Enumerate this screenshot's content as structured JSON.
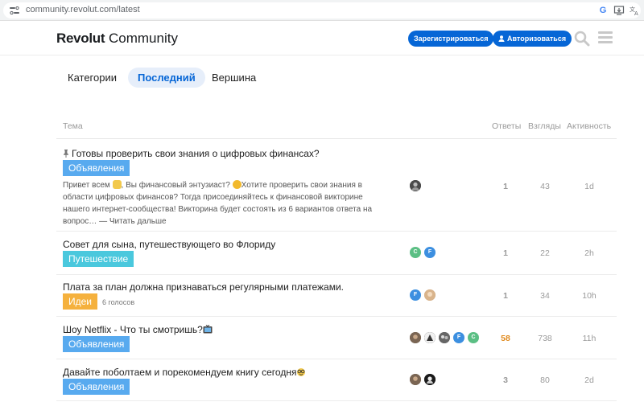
{
  "browser": {
    "url": "community.revolut.com/latest"
  },
  "header": {
    "brand": "Revolut",
    "brand_suffix": "Community",
    "signup_label": "Зарегистрироваться",
    "login_label": "Авторизоваться",
    "colors": {
      "primary": "#0666d6"
    }
  },
  "nav": {
    "tabs": [
      {
        "label": "Категории"
      },
      {
        "label": "Последний"
      },
      {
        "label": "Вершина"
      }
    ]
  },
  "table": {
    "headers": {
      "topic": "Тема",
      "replies": "Ответы",
      "views": "Взгляды",
      "activity": "Активность"
    },
    "rows": [
      {
        "title": "Готовы проверить свои знания о цифровых финансах?",
        "category": "Объявления",
        "category_color": "#58aaef",
        "excerpt_1": "Привет всем",
        "excerpt_2": ", Вы финансовый энтузиаст?",
        "excerpt_3": "Хотите проверить свои знания в области цифровых финансов? Тогда присоединяйтесь к финансовой викторине нашего интернет-сообщества! Викторина будет состоять из 6 вариантов ответа на вопрос…",
        "read_more": "— Читать дальше",
        "replies": "1",
        "views": "43",
        "activity": "1d"
      },
      {
        "title": "Совет для сына, путешествующего во Флориду",
        "category": "Путешествие",
        "category_color": "#4ac8dd",
        "avatars": [
          "C",
          "F"
        ],
        "replies": "1",
        "views": "22",
        "activity": "2h"
      },
      {
        "title": "Плата за план должна признаваться регулярными платежами.",
        "category": "Идеи",
        "category_color": "#f5b13d",
        "tags": "6 голосов",
        "avatars": [
          "F"
        ],
        "replies": "1",
        "views": "34",
        "activity": "10h"
      },
      {
        "title": "Шоу Netflix - Что ты смотришь?",
        "category": "Объявления",
        "category_color": "#58aaef",
        "avatars": [
          "F",
          "C"
        ],
        "replies": "58",
        "views": "738",
        "activity": "11h"
      },
      {
        "title": "Давайте поболтаем и порекомендуем книгу сегодня",
        "category": "Объявления",
        "category_color": "#58aaef",
        "replies": "3",
        "views": "80",
        "activity": "2d"
      }
    ]
  }
}
